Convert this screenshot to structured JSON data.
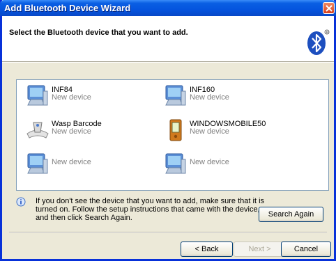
{
  "window": {
    "title": "Add Bluetooth Device Wizard"
  },
  "header": {
    "title": "Select the Bluetooth device that you want to add."
  },
  "devices": [
    {
      "name": "INF84",
      "status": "New device",
      "icon": "computer-icon"
    },
    {
      "name": "INF160",
      "status": "New device",
      "icon": "computer-icon"
    },
    {
      "name": "Wasp Barcode",
      "status": "New device",
      "icon": "barcode-scanner-icon"
    },
    {
      "name": "WINDOWSMOBILE50",
      "status": "New device",
      "icon": "pda-icon"
    },
    {
      "name": "",
      "status": "New device",
      "icon": "computer-icon"
    },
    {
      "name": "",
      "status": "New device",
      "icon": "computer-icon"
    }
  ],
  "info": {
    "text": "If you don't see the device that you want to add, make sure that it is turned on. Follow the setup instructions that came with the device, and then click Search Again."
  },
  "buttons": {
    "search_again": "Search Again",
    "back": "< Back",
    "next": "Next >",
    "cancel": "Cancel"
  }
}
